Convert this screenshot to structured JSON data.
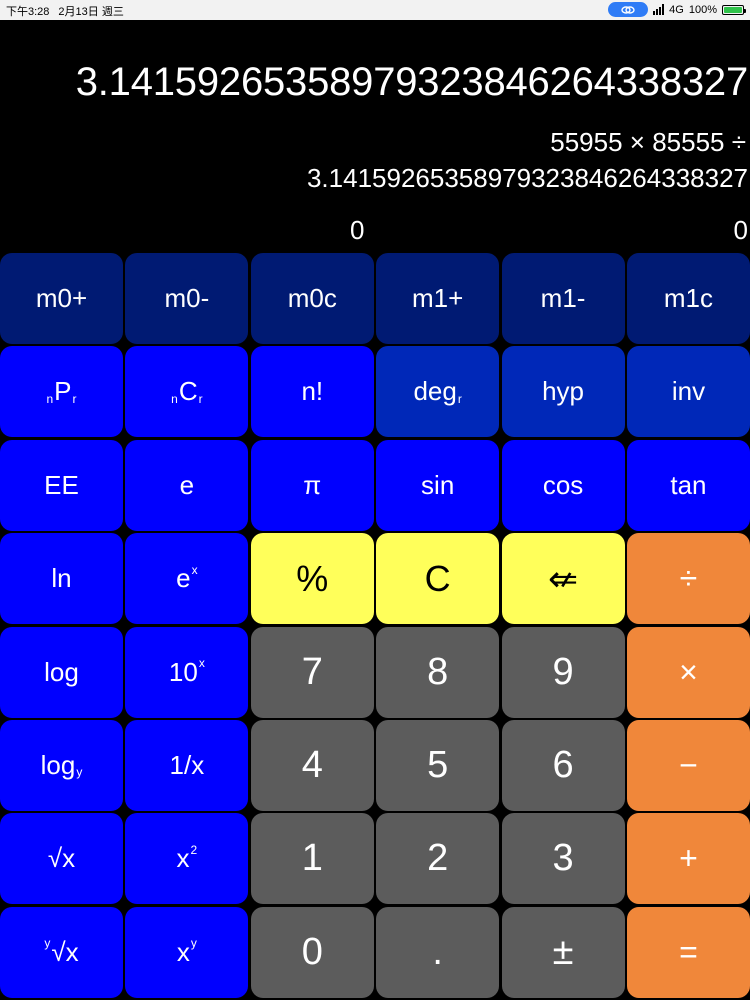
{
  "status_bar": {
    "time": "下午3:28",
    "date": "2月13日 週三",
    "network": "4G",
    "battery": "100%",
    "battery_level": 1.0
  },
  "display": {
    "main": "3.14159265358979323846264338327",
    "expression_line1": "55955 × 85555 ÷",
    "expression_line2": "3.14159265358979323846264338327",
    "memory0": "0",
    "memory1": "0"
  },
  "keys": {
    "m0_plus": "m0+",
    "m0_minus": "m0-",
    "m0_clear": "m0c",
    "m1_plus": "m1+",
    "m1_minus": "m1-",
    "m1_clear": "m1c",
    "npr_pre": "n",
    "npr_main": "P",
    "npr_sub": "r",
    "ncr_pre": "n",
    "ncr_main": "C",
    "ncr_sub": "r",
    "factorial": "n!",
    "deg_main": "deg",
    "deg_sub": "r",
    "hyp": "hyp",
    "inv": "inv",
    "ee": "EE",
    "e": "e",
    "pi": "π",
    "sin": "sin",
    "cos": "cos",
    "tan": "tan",
    "ln": "ln",
    "exp_main": "e",
    "exp_sup": "x",
    "percent": "%",
    "clear": "C",
    "backspace": "⇍",
    "divide": "÷",
    "log": "log",
    "pow10_main": "10",
    "pow10_sup": "x",
    "seven": "7",
    "eight": "8",
    "nine": "9",
    "multiply": "×",
    "logy_main": "log",
    "logy_sub": "y",
    "reciprocal": "1/x",
    "four": "4",
    "five": "5",
    "six": "6",
    "minus": "−",
    "sqrt": "√x",
    "square_main": "x",
    "square_sup": "2",
    "one": "1",
    "two": "2",
    "three": "3",
    "plus": "+",
    "yroot_pre": "y",
    "yroot_main": "√x",
    "power_main": "x",
    "power_sup": "y",
    "zero": "0",
    "decimal": ".",
    "negate": "±",
    "equals": "="
  },
  "colors": {
    "memory_keys": "#001a73",
    "scientific_keys_dark": "#0028b8",
    "scientific_keys": "#0000ff",
    "utility_keys": "#ffff5a",
    "number_keys": "#5c5c5c",
    "operator_keys": "#f0873a"
  }
}
